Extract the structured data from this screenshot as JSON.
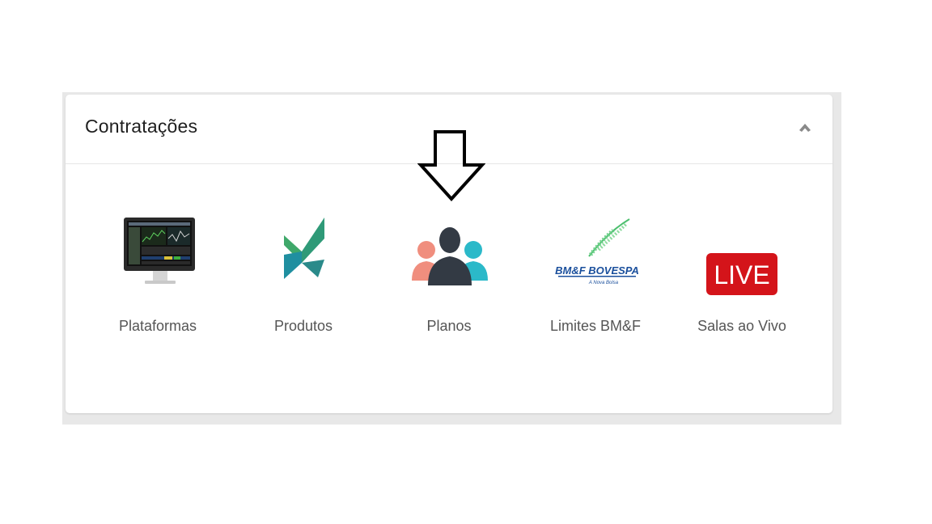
{
  "panel": {
    "title": "Contratações",
    "collapse_icon": "chevron-up-icon"
  },
  "tiles": [
    {
      "label": "Plataformas",
      "icon": "trading-monitor-icon"
    },
    {
      "label": "Produtos",
      "icon": "produtos-logo-icon"
    },
    {
      "label": "Planos",
      "icon": "users-group-icon"
    },
    {
      "label": "Limites BM&F",
      "icon": "bmf-bovespa-logo-icon",
      "logo_text": "BM&F BOVESPA",
      "logo_subtext": "A Nova Bolsa"
    },
    {
      "label": "Salas ao Vivo",
      "icon": "live-badge-icon",
      "badge_text": "LIVE"
    }
  ],
  "annotation": {
    "icon": "down-arrow-icon"
  },
  "colors": {
    "live_red": "#d4141a",
    "bmf_blue": "#1a4f9c",
    "bmf_green": "#4cbf6e",
    "people_dark": "#333a44",
    "people_salmon": "#f08e7e",
    "people_teal": "#2bb9c9",
    "produtos_green": "#3fa86a",
    "produtos_teal": "#1f8fa0"
  }
}
